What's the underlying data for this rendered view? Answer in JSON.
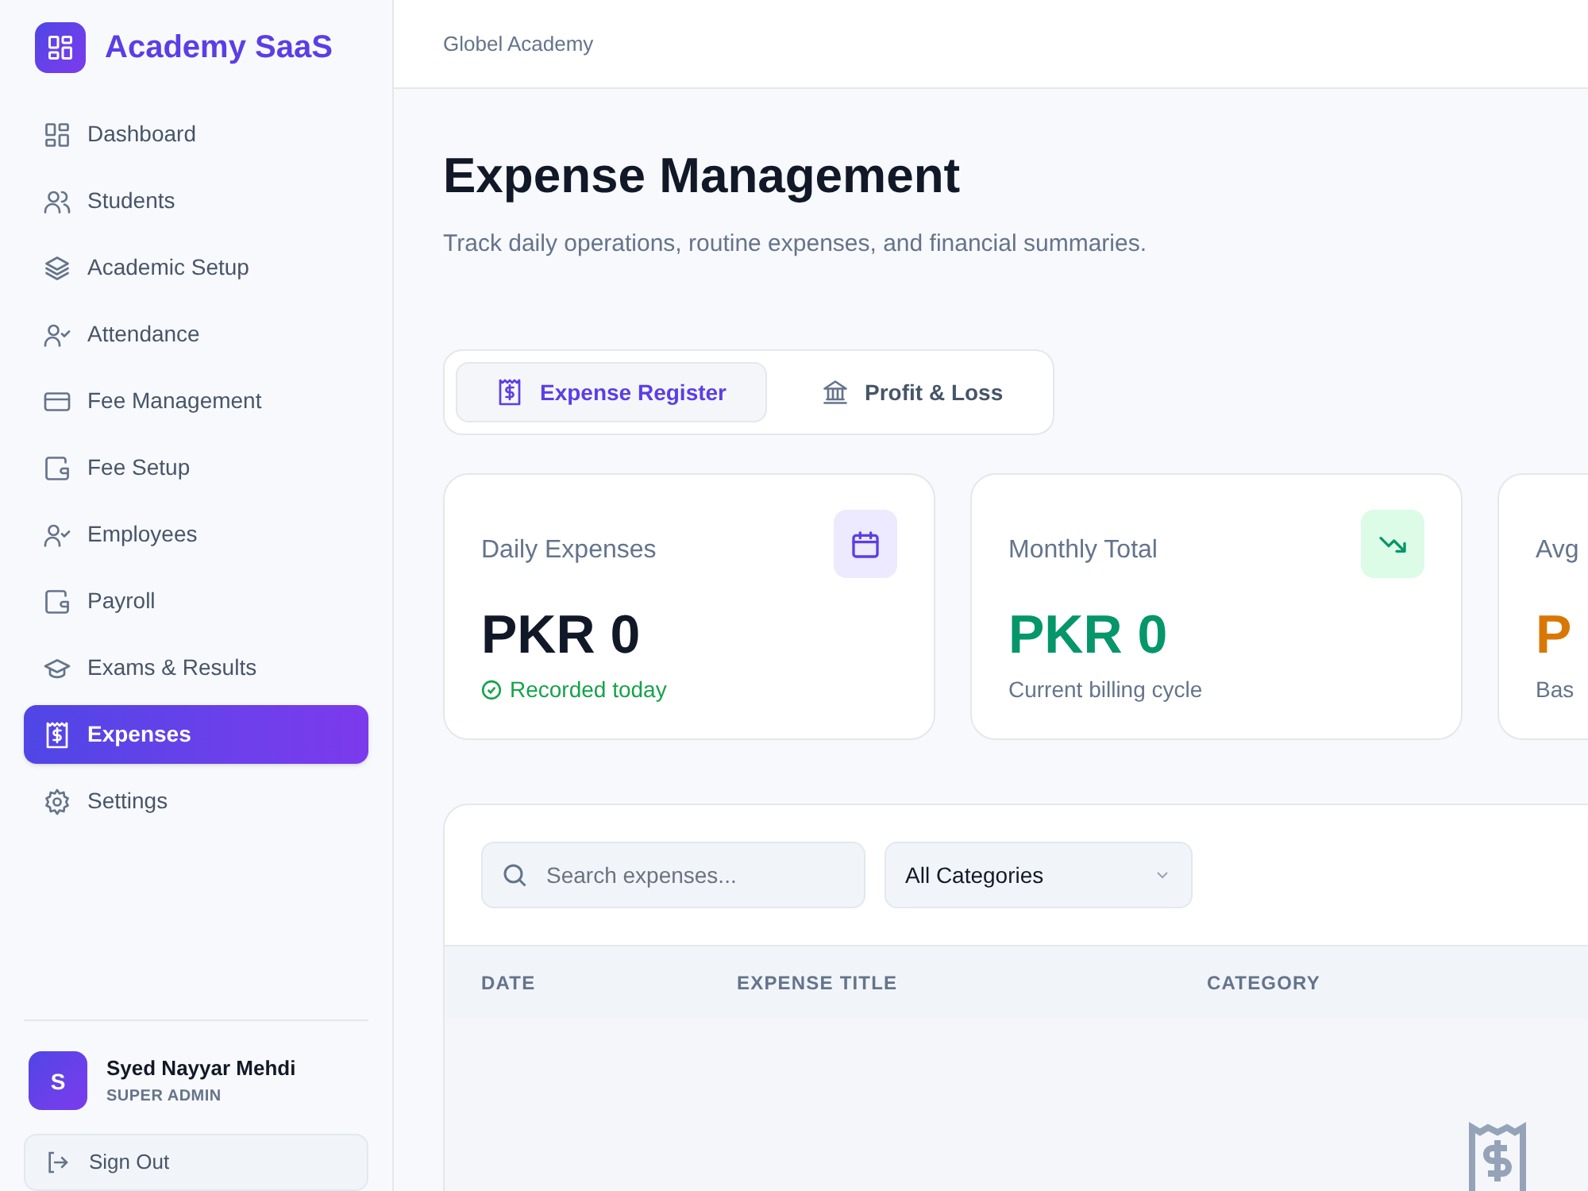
{
  "brand": {
    "name": "Academy SaaS"
  },
  "sidebar": {
    "items": [
      {
        "label": "Dashboard",
        "selected": false
      },
      {
        "label": "Students",
        "selected": false
      },
      {
        "label": "Academic Setup",
        "selected": false
      },
      {
        "label": "Attendance",
        "selected": false
      },
      {
        "label": "Fee Management",
        "selected": false
      },
      {
        "label": "Fee Setup",
        "selected": false
      },
      {
        "label": "Employees",
        "selected": false
      },
      {
        "label": "Payroll",
        "selected": false
      },
      {
        "label": "Exams & Results",
        "selected": false
      },
      {
        "label": "Expenses",
        "selected": true
      },
      {
        "label": "Settings",
        "selected": false
      }
    ]
  },
  "user": {
    "initial": "S",
    "name": "Syed Nayyar Mehdi",
    "role": "SUPER ADMIN",
    "sign_out": "Sign Out"
  },
  "header": {
    "academy": "Globel Academy"
  },
  "page": {
    "title": "Expense Management",
    "subtitle": "Track daily operations, routine expenses, and financial summaries."
  },
  "tabs": [
    {
      "label": "Expense Register",
      "selected": true
    },
    {
      "label": "Profit & Loss",
      "selected": false
    }
  ],
  "cards": [
    {
      "title": "Daily Expenses",
      "value": "PKR 0",
      "note": "Recorded today",
      "kind": "daily"
    },
    {
      "title": "Monthly Total",
      "value": "PKR 0",
      "note": "Current billing cycle",
      "kind": "monthly"
    },
    {
      "title": "Avg",
      "value": "P",
      "note": "Bas",
      "kind": "average"
    }
  ],
  "filters": {
    "search_placeholder": "Search expenses...",
    "category": "All Categories"
  },
  "table": {
    "columns": [
      "DATE",
      "EXPENSE TITLE",
      "CATEGORY"
    ]
  }
}
